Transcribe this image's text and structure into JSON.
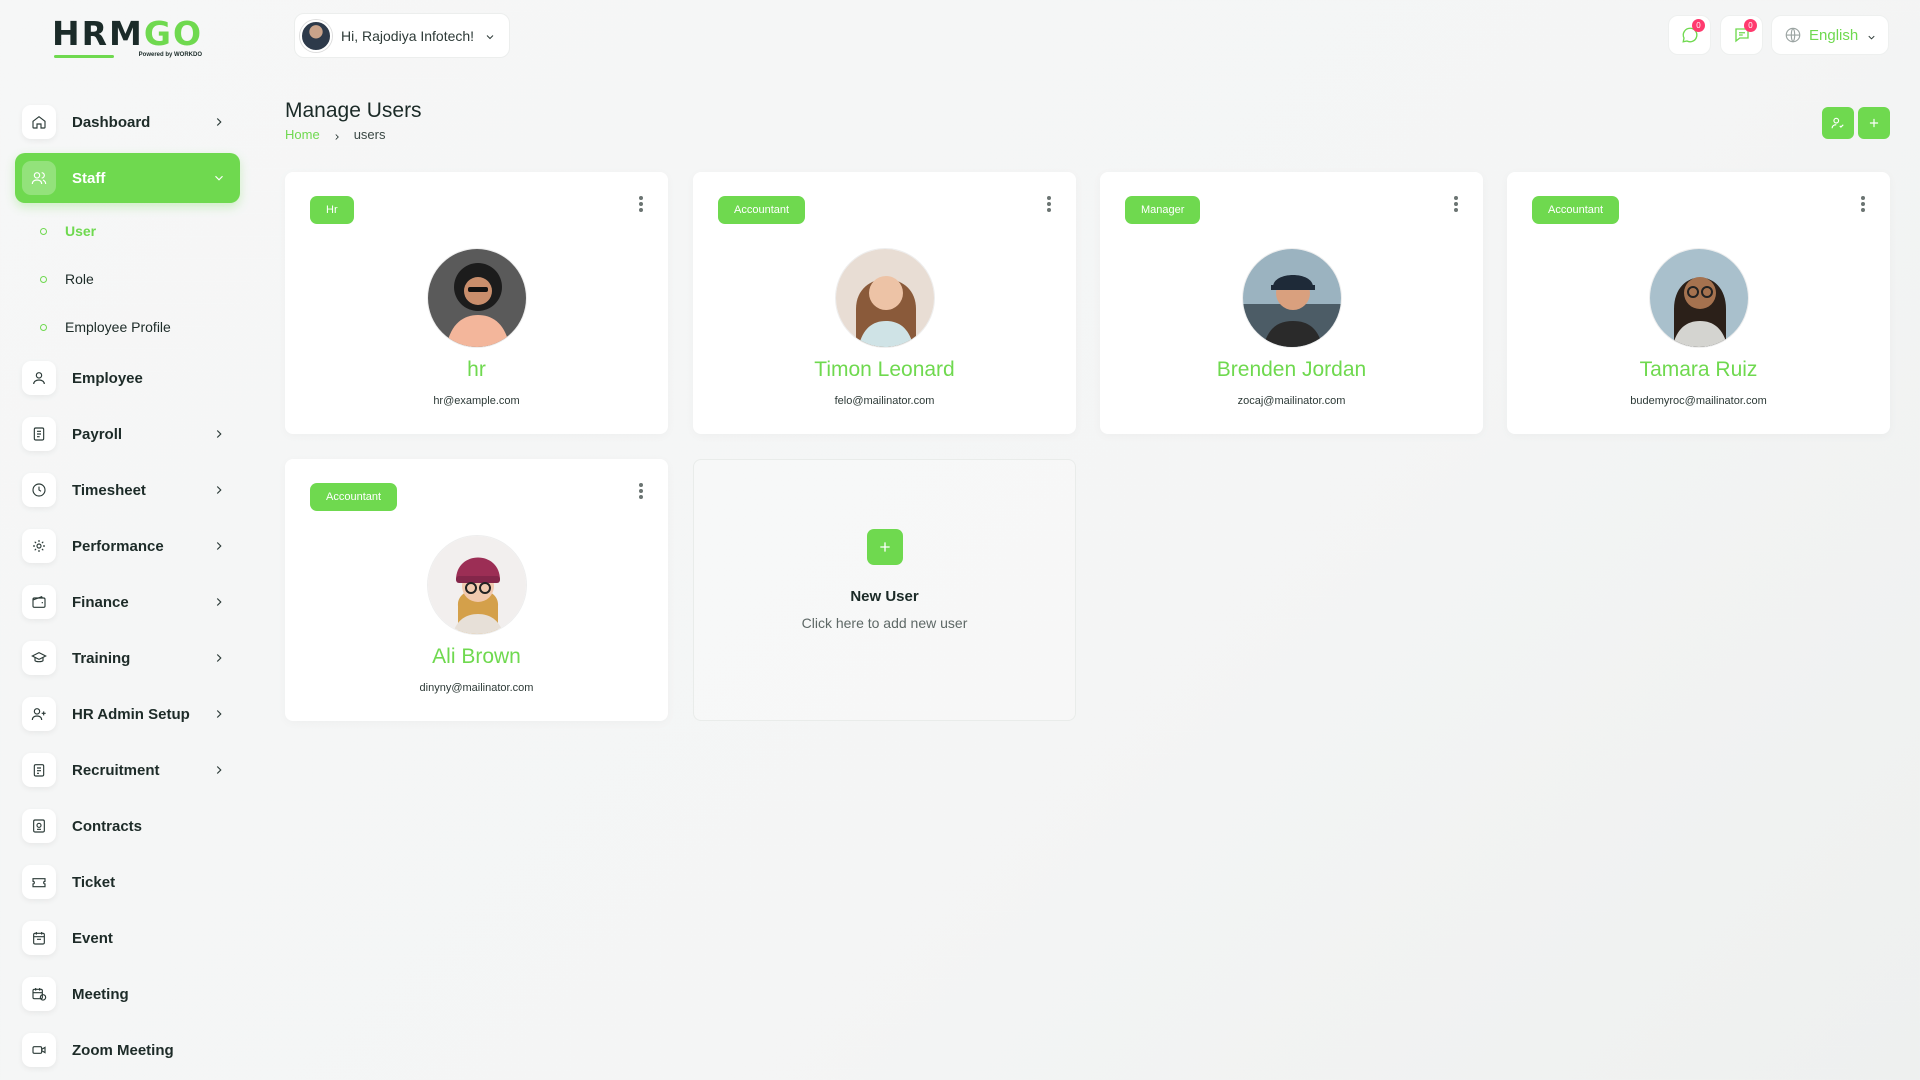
{
  "brand": {
    "logo_main": "HRM",
    "logo_go": "GO",
    "logo_sub": "Powered by WORKDO"
  },
  "header": {
    "greeting": "Hi, Rajodiya Infotech!",
    "messages_badge": "0",
    "notifications_badge": "0",
    "language": "English"
  },
  "sidebar": {
    "items": [
      {
        "label": "Dashboard"
      },
      {
        "label": "Staff"
      },
      {
        "label": "Employee"
      },
      {
        "label": "Payroll"
      },
      {
        "label": "Timesheet"
      },
      {
        "label": "Performance"
      },
      {
        "label": "Finance"
      },
      {
        "label": "Training"
      },
      {
        "label": "HR Admin Setup"
      },
      {
        "label": "Recruitment"
      },
      {
        "label": "Contracts"
      },
      {
        "label": "Ticket"
      },
      {
        "label": "Event"
      },
      {
        "label": "Meeting"
      },
      {
        "label": "Zoom Meeting"
      }
    ],
    "staff_sub": [
      {
        "label": "User"
      },
      {
        "label": "Role"
      },
      {
        "label": "Employee Profile"
      }
    ]
  },
  "page": {
    "title": "Manage Users",
    "breadcrumb_home": "Home",
    "breadcrumb_current": "users"
  },
  "users": [
    {
      "role": "Hr",
      "name": "hr",
      "email": "hr@example.com"
    },
    {
      "role": "Accountant",
      "name": "Timon Leonard",
      "email": "felo@mailinator.com"
    },
    {
      "role": "Manager",
      "name": "Brenden Jordan",
      "email": "zocaj@mailinator.com"
    },
    {
      "role": "Accountant",
      "name": "Tamara Ruiz",
      "email": "budemyroc@mailinator.com"
    },
    {
      "role": "Accountant",
      "name": "Ali Brown",
      "email": "dinyny@mailinator.com"
    }
  ],
  "new_user": {
    "title": "New User",
    "subtitle": "Click here to add new user"
  },
  "colors": {
    "accent": "#6fd94f",
    "badge": "#ff3a6e"
  }
}
